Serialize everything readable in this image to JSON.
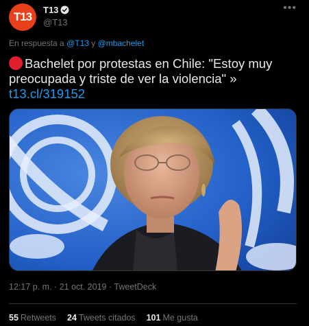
{
  "author": {
    "avatar_text": "T13",
    "display_name": "T13",
    "handle": "@T13",
    "verified": true,
    "avatar_color": "#e8401a"
  },
  "reply_to": {
    "prefix": "En respuesta a",
    "mention1": "@T13",
    "connector": "y",
    "mention2": "@mbachelet"
  },
  "tweet": {
    "text": "Bachelet por protestas en Chile: \"Estoy muy preocupada y triste de ver la violencia\" »",
    "link": "t13.cl/319152",
    "emoji": "red-circle-icon"
  },
  "meta": {
    "time": "12:17 p. m.",
    "separator1": "·",
    "date": "21 oct. 2019",
    "separator2": "·",
    "source": "TweetDeck"
  },
  "stats": {
    "retweets_count": "55",
    "retweets_label": "Retweets",
    "quotes_count": "24",
    "quotes_label": "Tweets citados",
    "likes_count": "101",
    "likes_label": "Me gusta"
  },
  "colors": {
    "background": "#000000",
    "link": "#1d9bf0",
    "secondary_text": "#71767b",
    "accent_red": "#dd1f2d"
  }
}
